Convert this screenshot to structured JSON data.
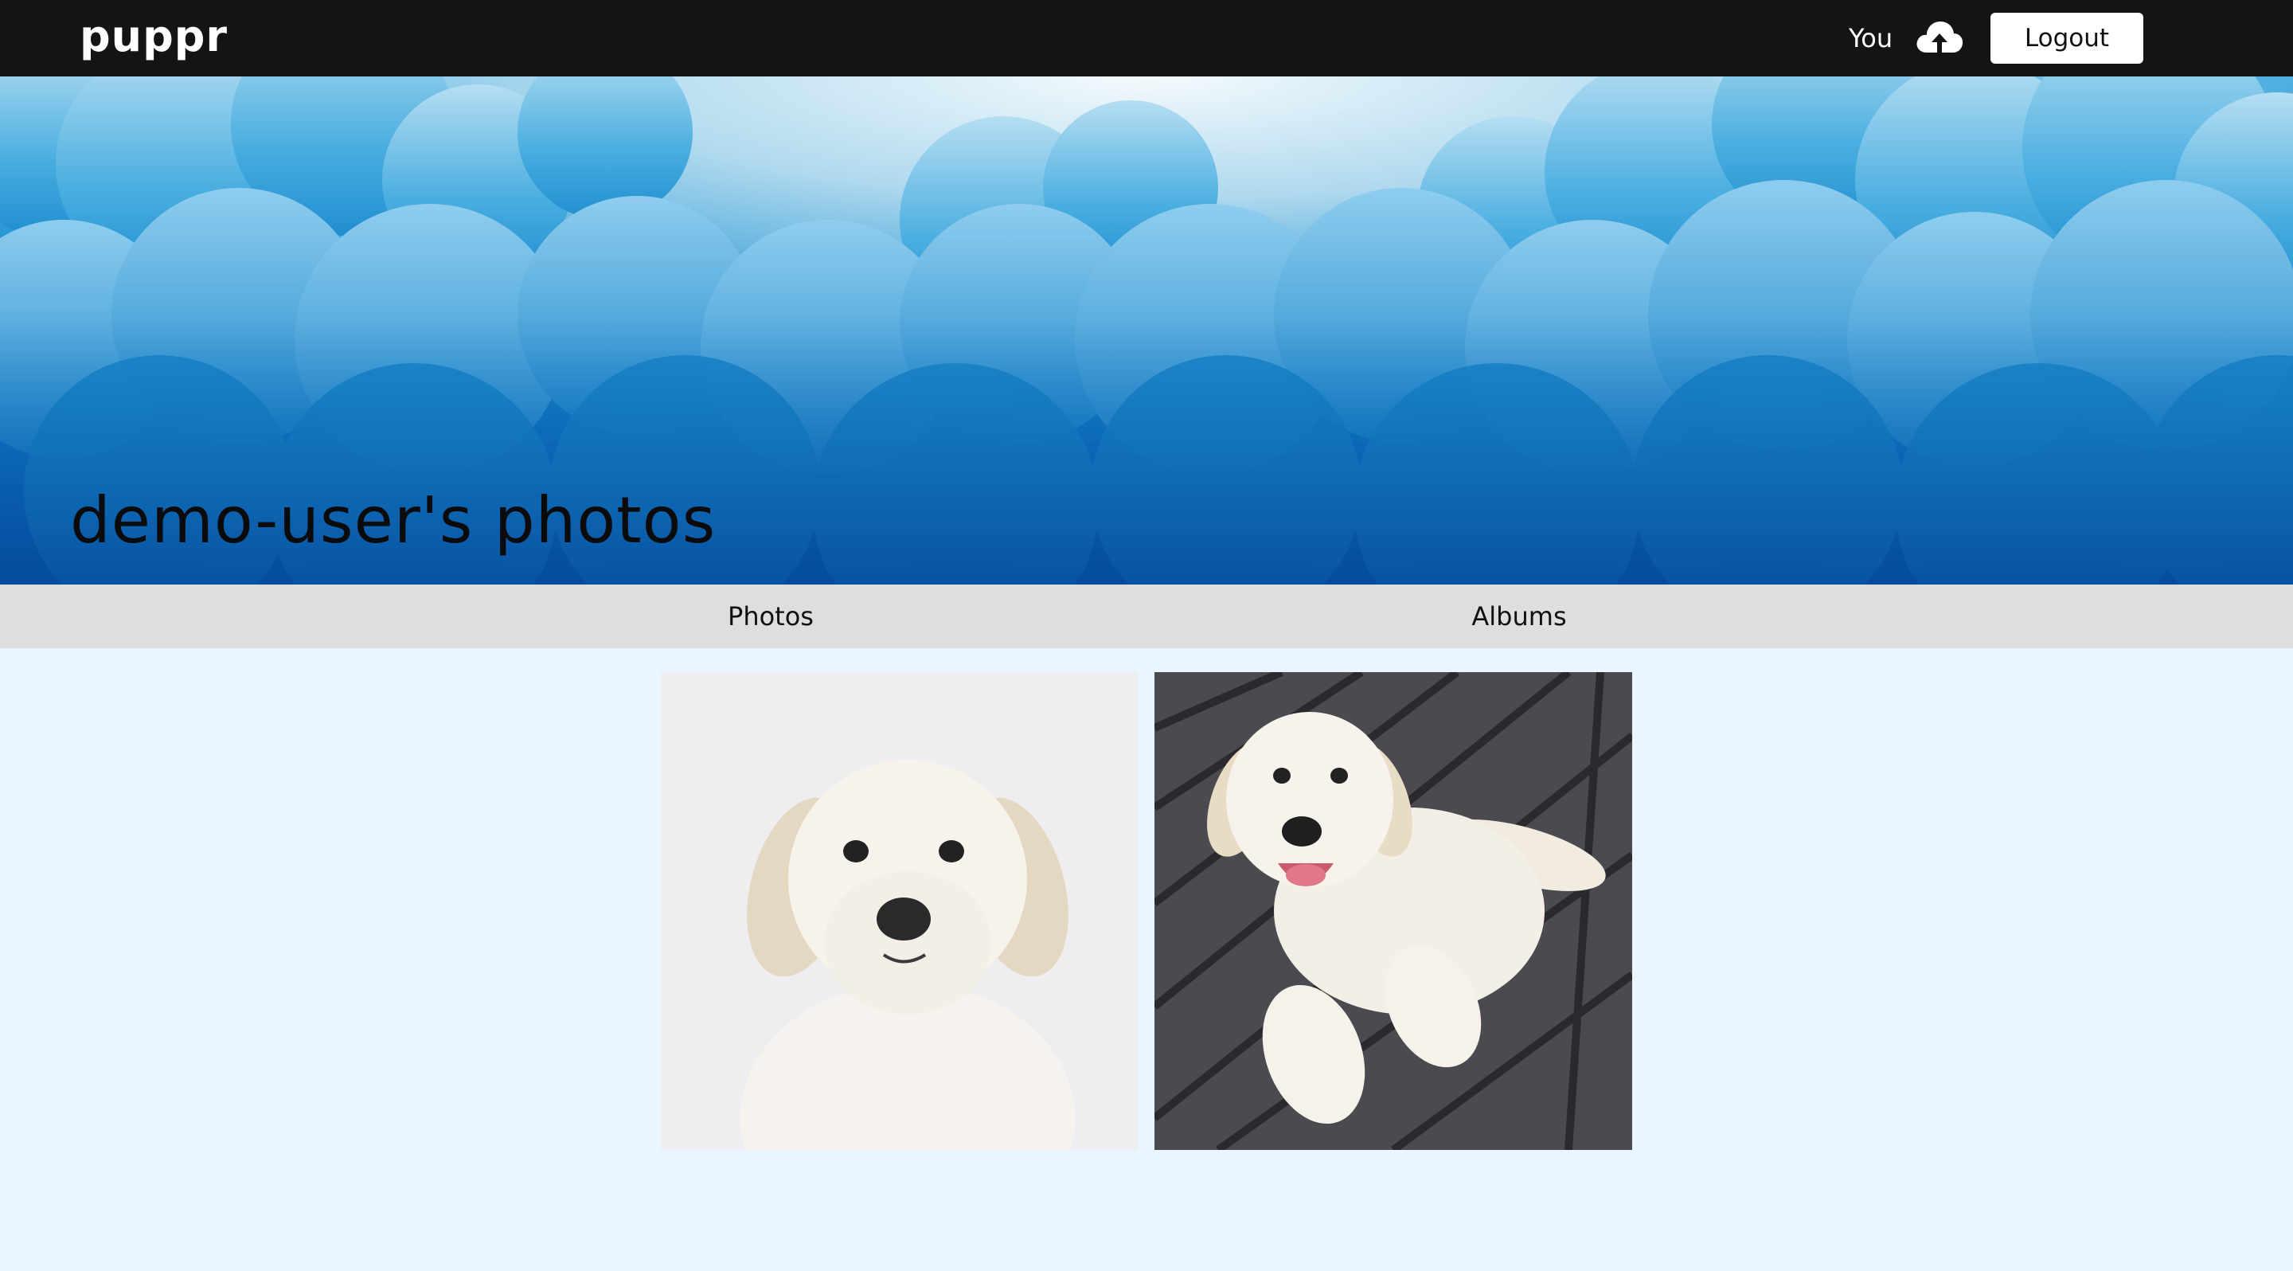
{
  "navbar": {
    "logo": "puppr",
    "you_label": "You",
    "upload_icon": "cloud-upload-icon",
    "logout_label": "Logout"
  },
  "banner": {
    "title": "demo-user's photos"
  },
  "tabs": [
    {
      "label": "Photos"
    },
    {
      "label": "Albums"
    }
  ],
  "photos": [
    {
      "subject": "white puppy sitting on white background"
    },
    {
      "subject": "white puppy lying on wooden deck"
    }
  ],
  "colors": {
    "navbar_bg": "#141417",
    "page_bg": "#eaf6ff",
    "tabs_bg": "#dedede",
    "sky_blue": "#1d8fd1"
  }
}
